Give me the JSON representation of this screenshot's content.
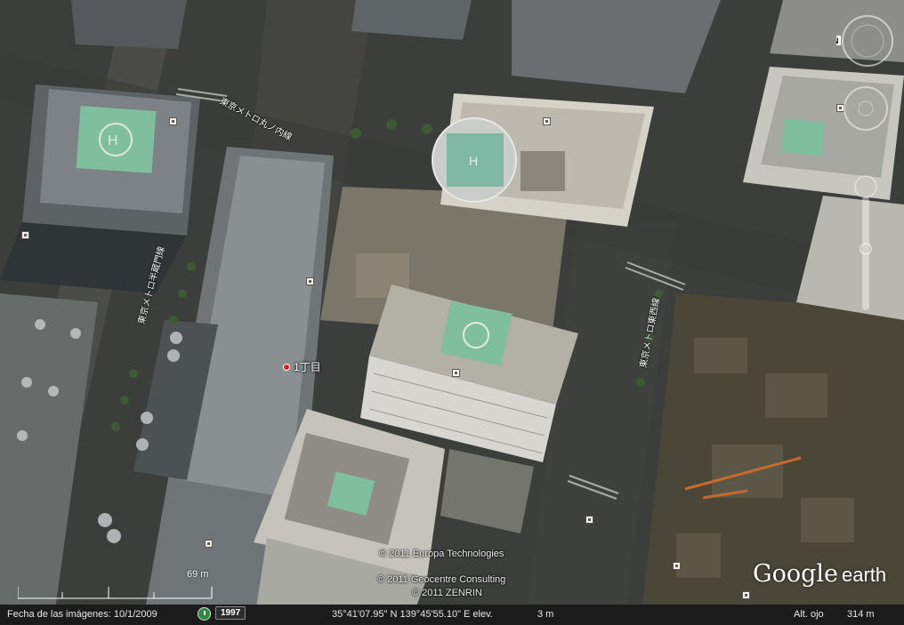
{
  "map": {
    "road_labels": [
      "東京メトロ丸ノ内線",
      "東京メトロ半蔵門線",
      "東京メトロ東西線"
    ],
    "place_label": "1丁目",
    "credits": [
      "© 2011 Europa Technologies",
      "© 2011 Geocentre Consulting",
      "© 2011 ZENRIN"
    ],
    "scale": "69 m",
    "logo": {
      "google": "Google",
      "earth": "earth"
    }
  },
  "status_bar": {
    "imagery_date_label": "Fecha de las imágenes: 10/1/2009",
    "year_button": "1997",
    "coordinates": "35°41'07.95\" N 139°45'55.10\" E elev.",
    "elevation": "3 m",
    "eye_alt_label": "Alt. ojo",
    "eye_alt_value": "314 m"
  },
  "colors": {
    "helipad_green": "#7fbf9e",
    "status_bg": "#1b1b1b",
    "place_dot": "#e02020"
  },
  "icons": [
    "clock-icon",
    "navigation-compass-icon",
    "look-joystick-icon",
    "move-joystick-icon",
    "zoom-slider-icon",
    "north-icon",
    "map-poi-icon"
  ]
}
